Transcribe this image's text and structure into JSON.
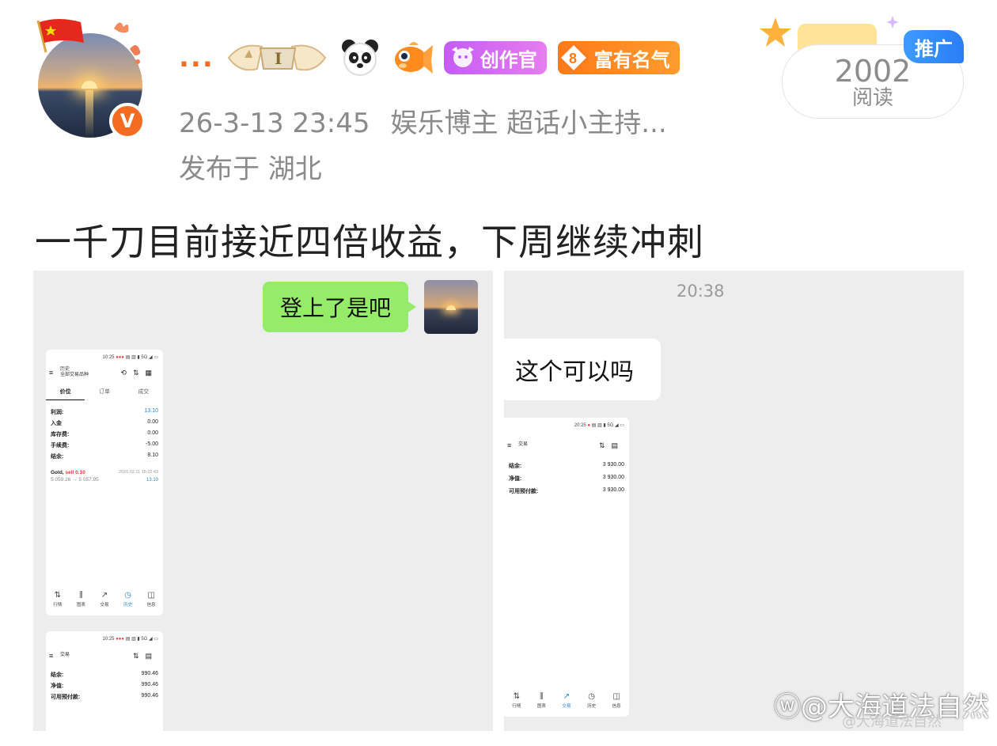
{
  "post": {
    "author": {
      "name": "...",
      "badges": {
        "creator": "创作官",
        "fame_level": "8",
        "fame": "富有名气"
      }
    },
    "meta": {
      "time": "26-3-13 23:45",
      "category": "娱乐博主 超话小主持...",
      "location": "发布于 湖北"
    },
    "reads": {
      "count": "2002",
      "label": "阅读"
    },
    "promo": "推广",
    "text": "一千刀目前接近四倍收益，下周继续冲刺"
  },
  "image1": {
    "chat_message": "登上了是吧",
    "phone1": {
      "status": "10:25",
      "title": "历史",
      "subtitle": "全部交易品种",
      "tabs": [
        "价位",
        "订单",
        "成交"
      ],
      "rows": [
        {
          "k": "利润:",
          "v": "13.10"
        },
        {
          "k": "入金",
          "v": "0.00"
        },
        {
          "k": "库存费:",
          "v": "0.00"
        },
        {
          "k": "手续费:",
          "v": "-5.00"
        },
        {
          "k": "结余:",
          "v": "8.10"
        }
      ],
      "trade": {
        "symbol": "Gold,",
        "side": "sell 0.10",
        "date": "2026.02.11 15:22:43",
        "prices": "5 059.26 → 5 057.95",
        "profit": "13.10"
      },
      "nav": [
        "行情",
        "图表",
        "交易",
        "历史",
        "信息"
      ]
    },
    "phone2": {
      "status": "10:25",
      "title": "交易",
      "rows": [
        {
          "k": "结余:",
          "v": "990.46"
        },
        {
          "k": "净值:",
          "v": "990.46"
        },
        {
          "k": "可用预付款:",
          "v": "990.46"
        }
      ]
    }
  },
  "image2": {
    "time": "20:38",
    "chat_message": "这个可以吗",
    "phone3": {
      "status": "20:25",
      "title": "交易",
      "rows": [
        {
          "k": "结余:",
          "v": "3 930.00"
        },
        {
          "k": "净值:",
          "v": "3 930.00"
        },
        {
          "k": "可用预付款:",
          "v": "3 930.00"
        }
      ],
      "nav": [
        "行情",
        "图表",
        "交易",
        "历史",
        "信息"
      ]
    }
  },
  "watermark": {
    "main": "@大海道法自然",
    "sub": "@大海道法自然"
  },
  "colors": {
    "accent": "#f36c22",
    "chat_green": "#95ec69",
    "promo_blue": "#2a7ef5",
    "creator_purple": "#c45cf5"
  }
}
